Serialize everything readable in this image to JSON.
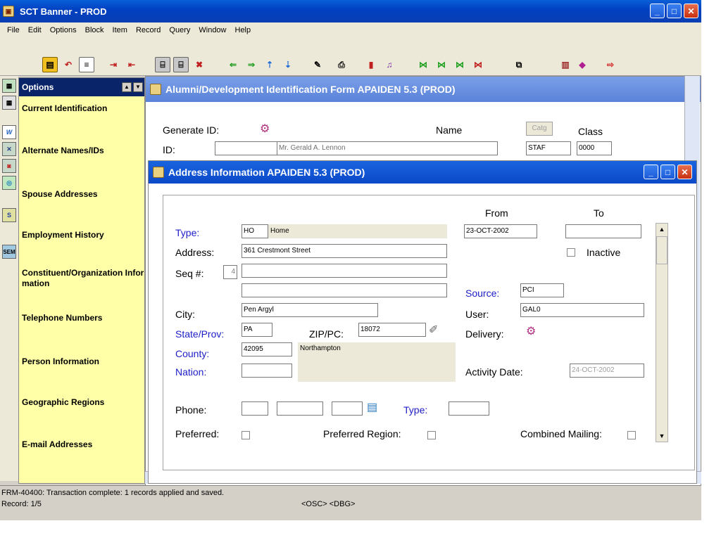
{
  "app": {
    "title": "SCT Banner - PROD",
    "menu": [
      "File",
      "Edit",
      "Options",
      "Block",
      "Item",
      "Record",
      "Query",
      "Window",
      "Help"
    ]
  },
  "options_panel": {
    "header": "Options",
    "items": [
      "Current Identification",
      "Alternate Names/IDs",
      "Spouse Addresses",
      "Employment History",
      "Constituent/Organization Information",
      "Telephone Numbers",
      "Person Information",
      "Geographic Regions",
      "E-mail Addresses"
    ]
  },
  "id_form": {
    "title": "Alumni/Development Identification Form  APAIDEN  5.3  (PROD)",
    "generate_id_label": "Generate ID:",
    "name_label": "Name",
    "catg_button": "Catg",
    "class_label": "Class",
    "id_label": "ID:",
    "id_value": "",
    "name_value": "Mr. Gerald A. Lennon",
    "catg_value": "STAF",
    "class_value": "0000"
  },
  "address": {
    "title": "Address Information  APAIDEN  5.3  (PROD)",
    "from_label": "From",
    "to_label": "To",
    "type_label": "Type:",
    "type_code": "HO",
    "type_desc": "Home",
    "from_date": "23-OCT-2002",
    "to_date": "",
    "address_label": "Address:",
    "address_line1": "361 Crestmont Street",
    "address_line2": "",
    "address_line3": "",
    "inactive_label": "Inactive",
    "seq_label": "Seq #:",
    "seq_value": "4",
    "source_label": "Source:",
    "source_value": "PCI",
    "city_label": "City:",
    "city_value": "Pen Argyl",
    "user_label": "User:",
    "user_value": "GAL0",
    "state_label": "State/Prov:",
    "state_value": "PA",
    "zip_label": "ZIP/PC:",
    "zip_value": "18072",
    "delivery_label": "Delivery:",
    "county_label": "County:",
    "county_code": "42095",
    "county_name": "Northampton",
    "nation_label": "Nation:",
    "nation_value": "",
    "activity_date_label": "Activity Date:",
    "activity_date_value": "24-OCT-2002",
    "phone_label": "Phone:",
    "phone_type_label": "Type:",
    "preferred_label": "Preferred:",
    "preferred_region_label": "Preferred Region:",
    "combined_mailing_label": "Combined Mailing:"
  },
  "status": {
    "message": "FRM-40400: Transaction complete: 1 records applied and saved.",
    "record": "Record: 1/5",
    "indicators": "<OSC> <DBG>"
  },
  "colors": {
    "options_bg": "#ffffa8",
    "blue_label": "#2020c8",
    "title_blue": "#0a48c8"
  }
}
